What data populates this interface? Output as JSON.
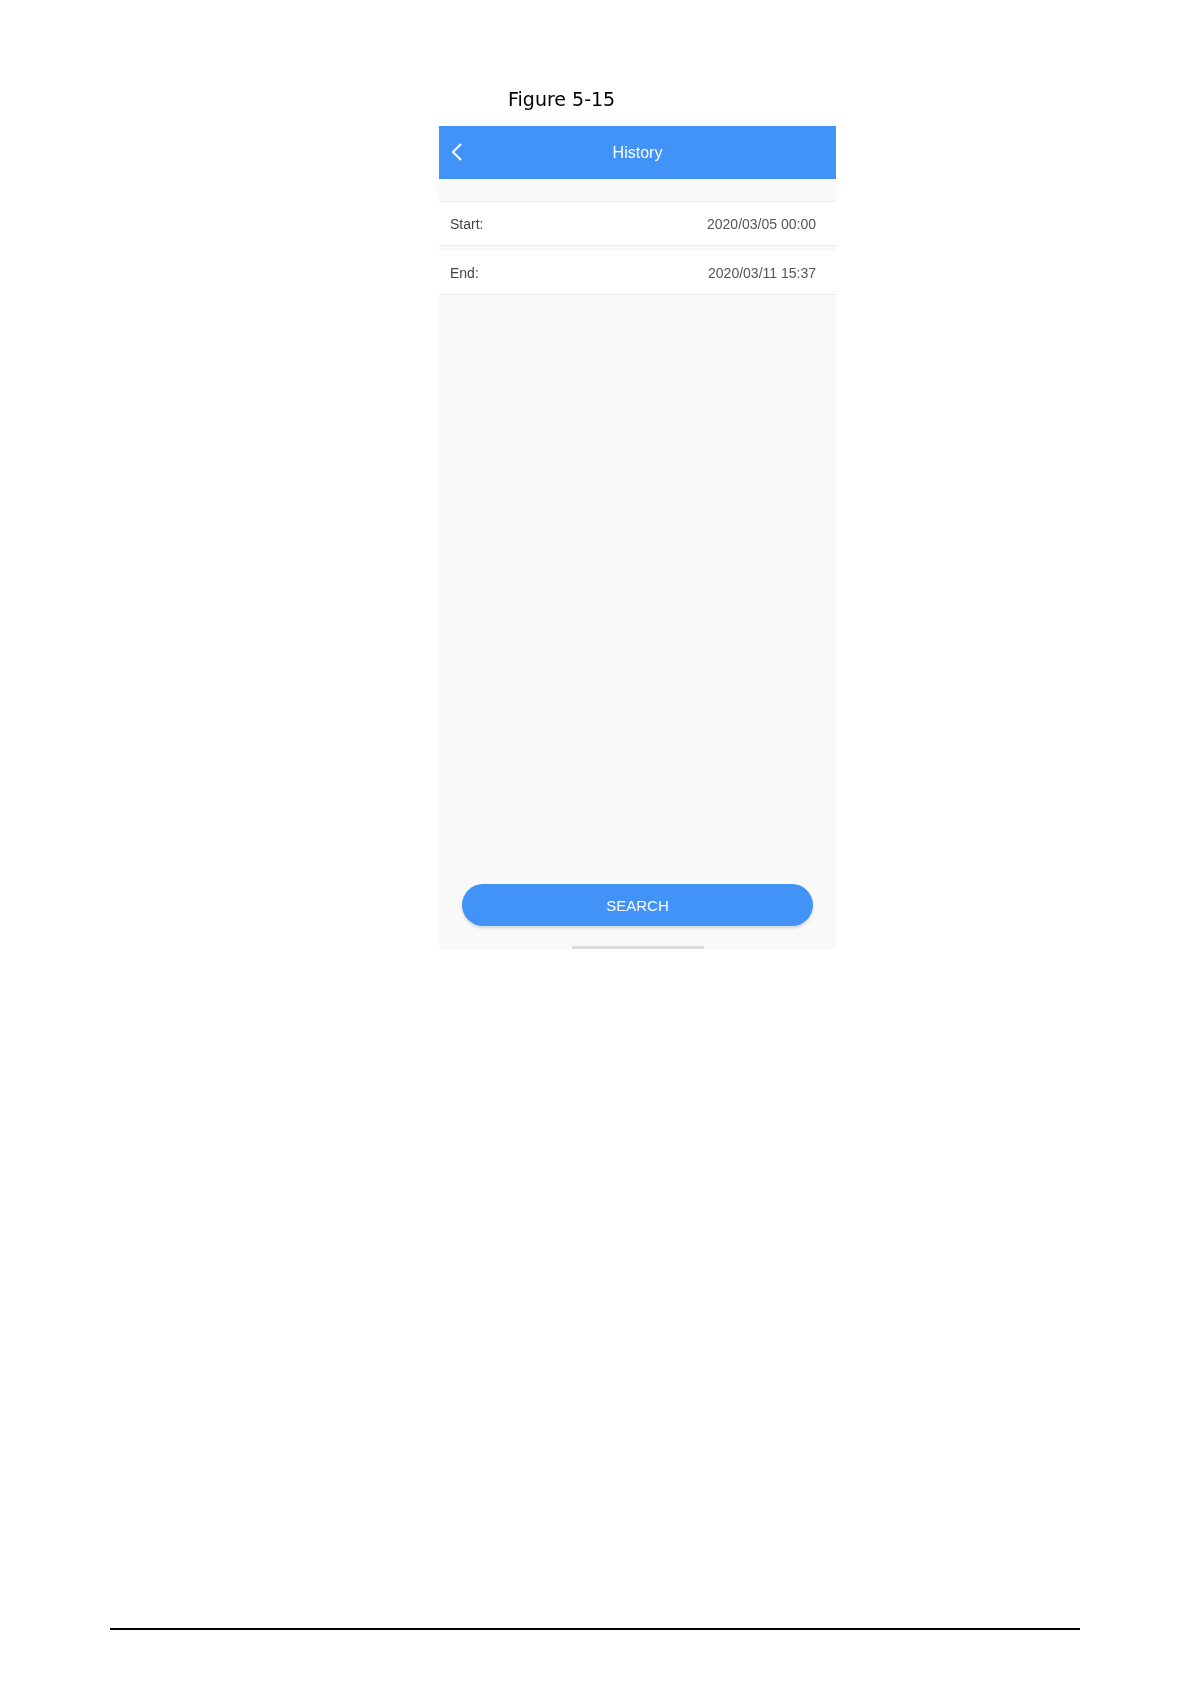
{
  "figure_caption": "Figure 5-15",
  "header": {
    "title": "History"
  },
  "fields": [
    {
      "label": "Start:",
      "value": "2020/03/05 00:00"
    },
    {
      "label": "End:",
      "value": "2020/03/11 15:37"
    }
  ],
  "search_button": "SEARCH"
}
